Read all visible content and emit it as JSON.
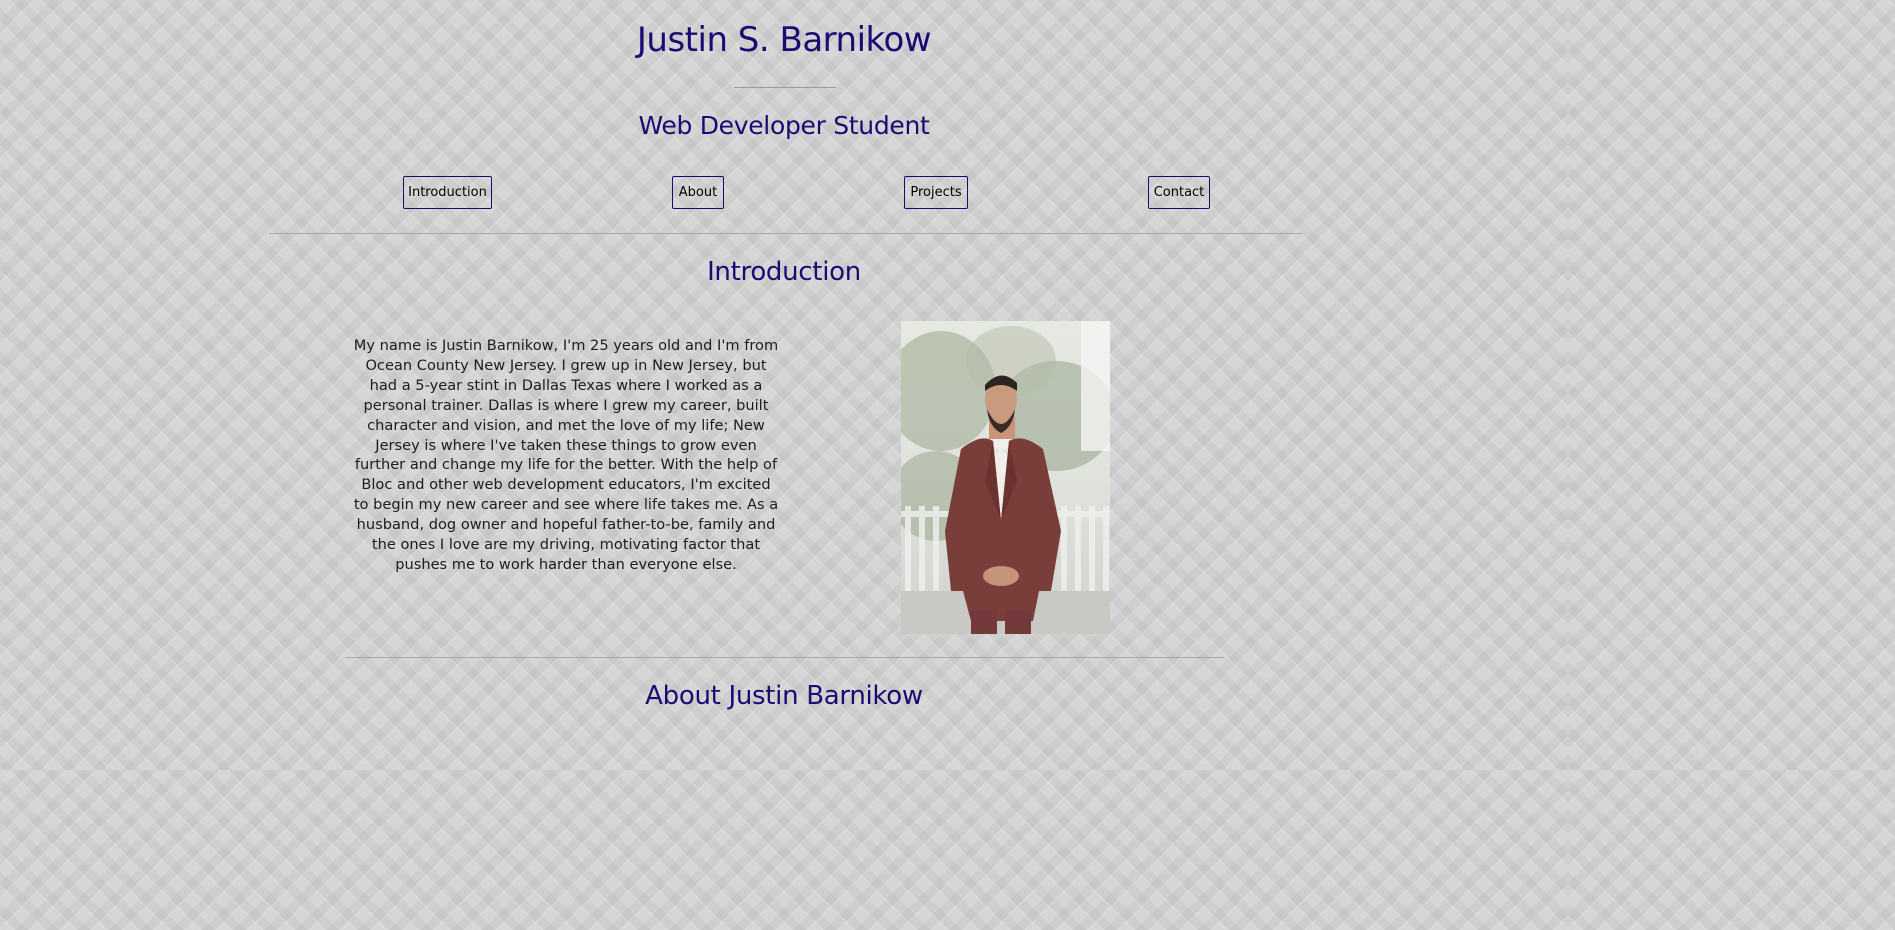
{
  "header": {
    "name": "Justin S. Barnikow",
    "tagline": "Web Developer Student"
  },
  "nav": {
    "introduction": "Introduction",
    "about": "About",
    "projects": "Projects",
    "contact": "Contact"
  },
  "intro": {
    "title": "Introduction",
    "body": "My name is Justin Barnikow, I'm 25 years old and I'm from Ocean County New Jersey. I grew up in New Jersey, but had a 5-year stint in Dallas Texas where I worked as a personal trainer. Dallas is where I grew my career, built character and vision, and met the love of my life; New Jersey is where I've taken these things to grow even further and change my life for the better. With the help of Bloc and other web development educators, I'm excited to begin my new career and see where life takes me. As a husband, dog owner and hopeful father-to-be, family and the ones I love are my driving, motivating factor that pushes me to work harder than everyone else."
  },
  "about": {
    "title": "About Justin Barnikow"
  },
  "colors": {
    "heading": "#1c0a73",
    "button_border": "#1c0a73",
    "background": "#d6d6d6",
    "suit": "#7a3e3a"
  }
}
